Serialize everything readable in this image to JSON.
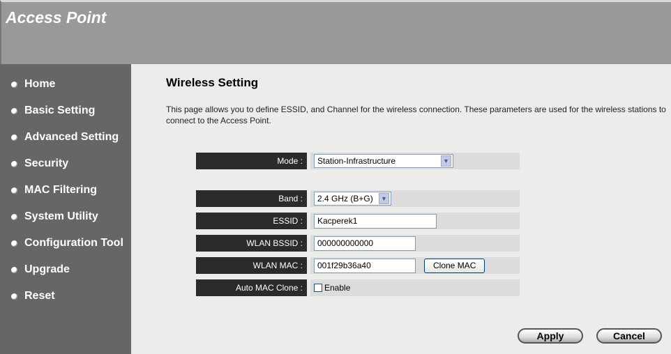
{
  "header": {
    "title": "Access Point"
  },
  "sidebar": {
    "items": [
      {
        "label": "Home"
      },
      {
        "label": "Basic Setting"
      },
      {
        "label": "Advanced Setting"
      },
      {
        "label": "Security"
      },
      {
        "label": "MAC Filtering"
      },
      {
        "label": "System Utility"
      },
      {
        "label": "Configuration Tool"
      },
      {
        "label": "Upgrade"
      },
      {
        "label": "Reset"
      }
    ]
  },
  "main": {
    "title": "Wireless Setting",
    "description": "This page allows you to define ESSID, and Channel for the wireless connection. These parameters are used for the wireless stations to connect to the Access Point.",
    "form": {
      "mode": {
        "label": "Mode :",
        "value": "Station-Infrastructure"
      },
      "band": {
        "label": "Band :",
        "value": "2.4 GHz (B+G)"
      },
      "essid": {
        "label": "ESSID :",
        "value": "Kacperek1"
      },
      "bssid": {
        "label": "WLAN BSSID :",
        "value": "000000000000"
      },
      "mac": {
        "label": "WLAN MAC :",
        "value": "001f29b36a40",
        "button": "Clone MAC"
      },
      "auto_clone": {
        "label": "Auto MAC Clone :",
        "checkbox_label": "Enable",
        "checked": false
      }
    },
    "apply": "Apply",
    "cancel": "Cancel"
  }
}
